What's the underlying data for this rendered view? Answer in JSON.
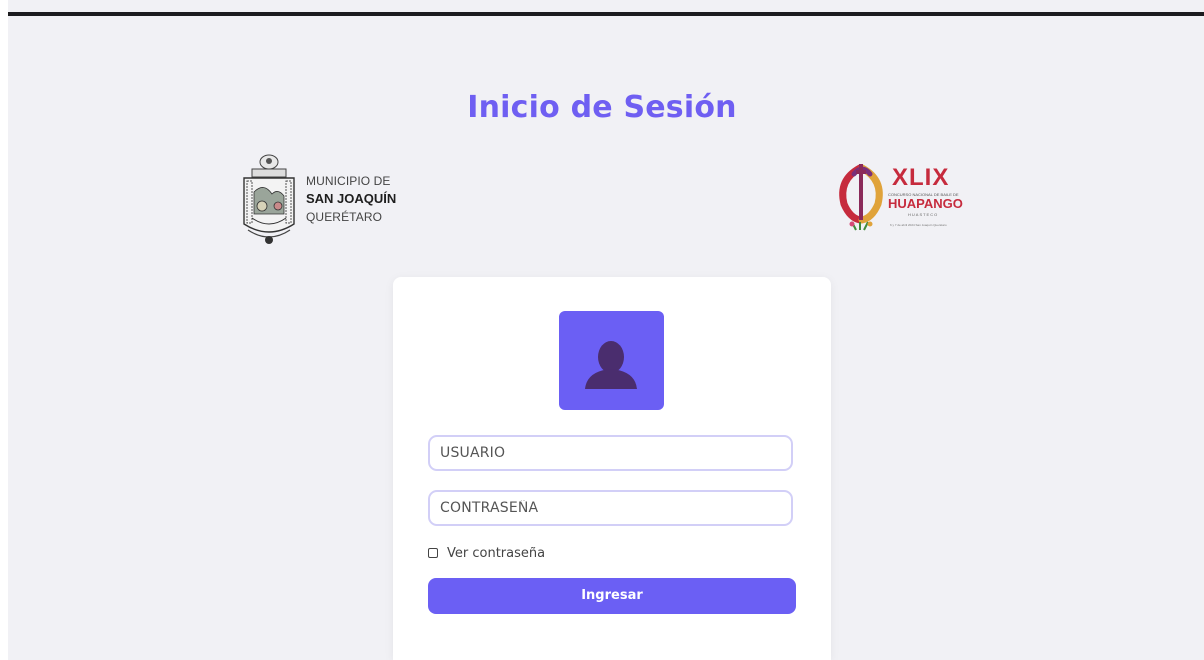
{
  "page": {
    "title": "Inicio de Sesión"
  },
  "logos": {
    "municipio": {
      "line1": "MUNICIPIO DE",
      "line2": "SAN JOAQUÍN",
      "line3": "QUERÉTARO"
    },
    "concurso": {
      "edition": "XLIX",
      "subtitle": "CONCURSO NACIONAL DE BAILE DE",
      "name": "HUAPANGO",
      "style": "HUASTECO",
      "dates": "6 y 7 de abril 2024 San Joaquín Querétaro"
    }
  },
  "login": {
    "avatar_icon": "user-silhouette-icon",
    "username": {
      "value": "",
      "placeholder": "USUARIO"
    },
    "password": {
      "value": "",
      "placeholder": "CONTRASEÑA"
    },
    "show_password": {
      "label": "Ver contraseña",
      "checked": false
    },
    "submit_label": "Ingresar"
  },
  "colors": {
    "accent": "#6b5ff4",
    "title": "#6f5ff2",
    "background": "#f1f1f5",
    "field_border": "#d2cff7",
    "brand_red": "#c62b3d"
  }
}
